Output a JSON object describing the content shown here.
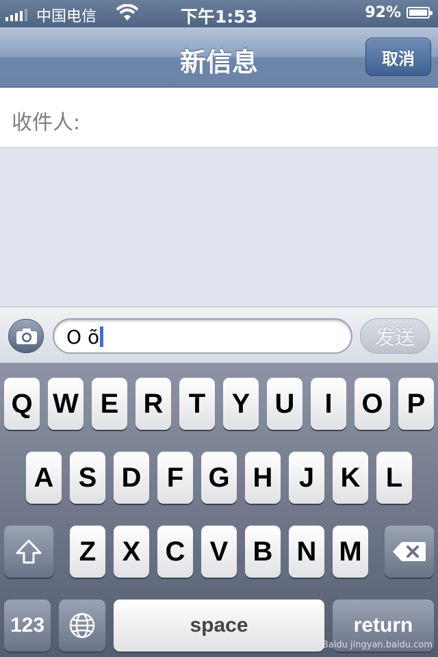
{
  "status_bar": {
    "carrier": "中国电信",
    "time": "下午1:53",
    "battery_percent": "92%",
    "battery_level": 0.92,
    "signal_bars": 4,
    "icons": [
      "signal-icon",
      "wifi-icon",
      "battery-icon"
    ]
  },
  "nav": {
    "title": "新信息",
    "cancel_label": "取消"
  },
  "recipient": {
    "label": "收件人:"
  },
  "compose": {
    "message_value": "O õ",
    "send_label": "发送",
    "camera_icon": "camera-icon"
  },
  "keyboard": {
    "row1": [
      "Q",
      "W",
      "E",
      "R",
      "T",
      "Y",
      "U",
      "I",
      "O",
      "P"
    ],
    "row2": [
      "A",
      "S",
      "D",
      "F",
      "G",
      "H",
      "J",
      "K",
      "L"
    ],
    "row3": [
      "Z",
      "X",
      "C",
      "V",
      "B",
      "N",
      "M"
    ],
    "numbers_label": "123",
    "space_label": "space",
    "return_label": "return",
    "shift_icon": "shift-icon",
    "globe_icon": "globe-icon",
    "backspace_icon": "backspace-icon"
  },
  "watermark": {
    "logo_text": "Baidu",
    "url": "jingyan.baidu.com"
  },
  "colors": {
    "nav_accent": "#6d87aa",
    "caret": "#3d6ee0",
    "background": "#dfe4ee"
  }
}
